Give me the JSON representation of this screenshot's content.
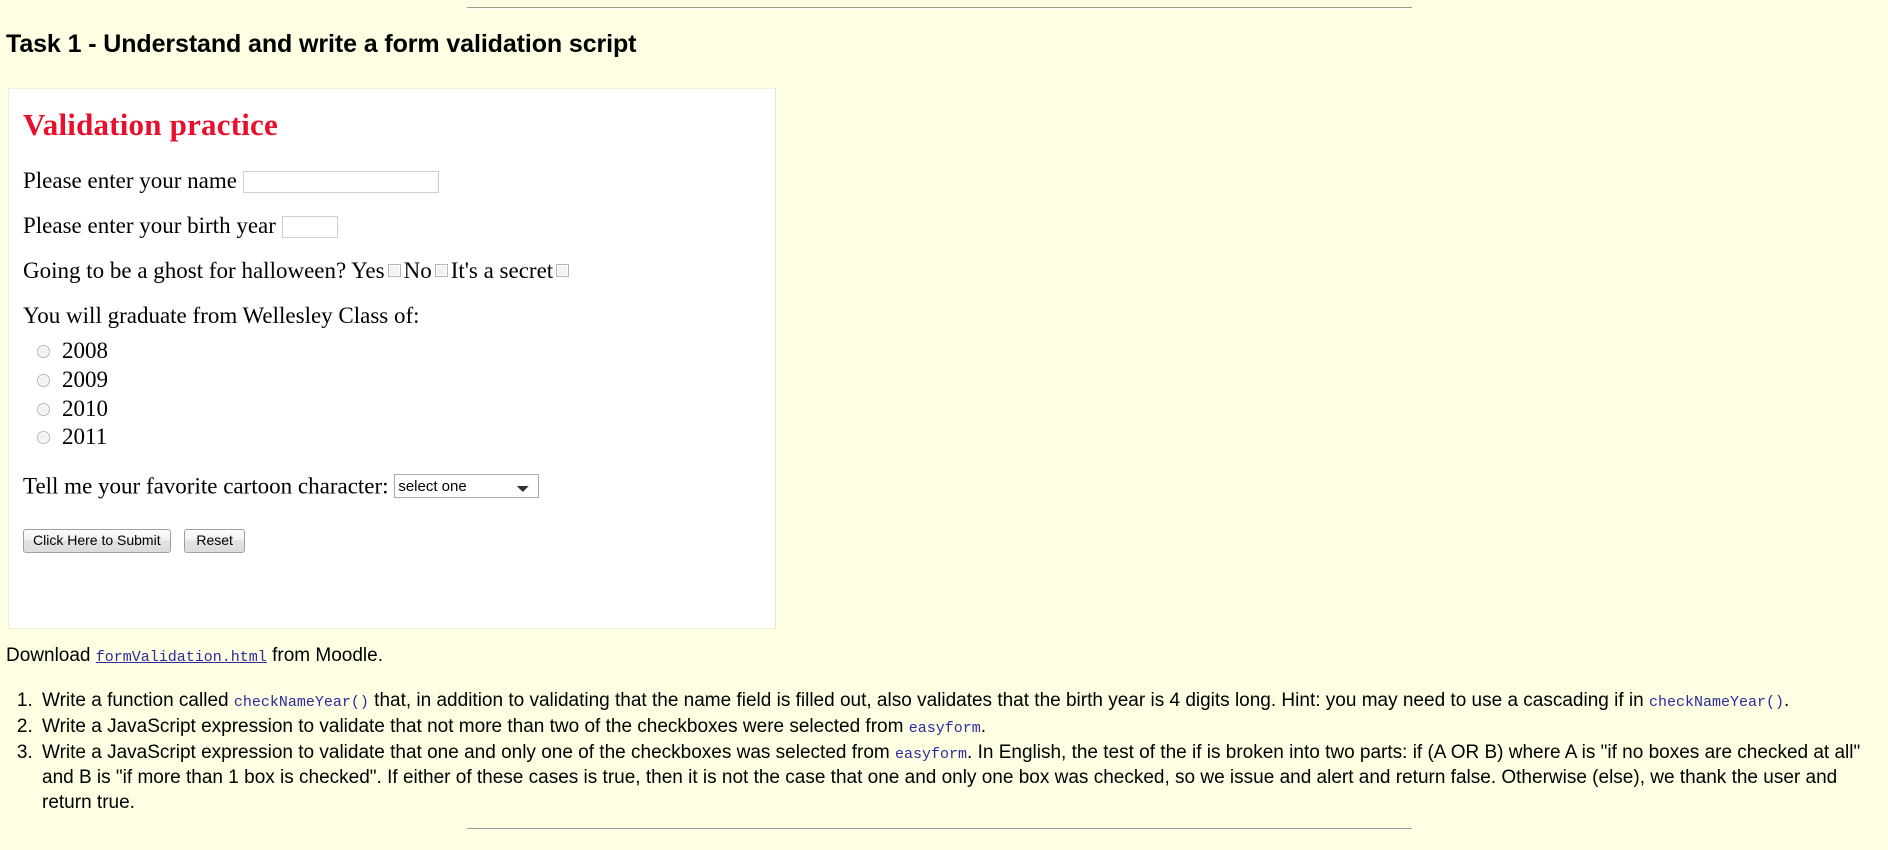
{
  "page": {
    "background_color": "#FEFEE3",
    "task_title": "Task 1 - Understand and write a form validation script"
  },
  "form_panel": {
    "heading": "Validation practice",
    "heading_color": "#E8112D",
    "name_row": {
      "label": "Please enter your name",
      "value": "",
      "placeholder": ""
    },
    "birth_year_row": {
      "label": "Please enter your birth year",
      "value": "",
      "placeholder": ""
    },
    "ghost_row": {
      "question": "Going to be a ghost for halloween?",
      "options": [
        {
          "label": "Yes",
          "checked": false
        },
        {
          "label": "No",
          "checked": false
        },
        {
          "label": "It's a secret",
          "checked": false
        }
      ]
    },
    "graduation": {
      "question": "You will graduate from Wellesley Class of:",
      "options": [
        {
          "label": "2008",
          "selected": false
        },
        {
          "label": "2009",
          "selected": false
        },
        {
          "label": "2010",
          "selected": false
        },
        {
          "label": "2011",
          "selected": false
        }
      ]
    },
    "cartoon_row": {
      "label": "Tell me your favorite cartoon character:",
      "selected": "select one",
      "options": [
        "select one"
      ]
    },
    "buttons": {
      "submit_label": "Click Here to Submit",
      "reset_label": "Reset"
    }
  },
  "download": {
    "before": "Download",
    "link_text": "formValidation.html",
    "after": "from Moodle."
  },
  "tasks": [
    {
      "part1": "Write a function called",
      "code1": "checkNameYear()",
      "part2": "that, in addition to validating that the name field is filled out, also validates that the birth year is 4 digits long. Hint: you may need to use a cascading if in",
      "code2": "checkNameYear()",
      "part3": "."
    },
    {
      "part1": "Write a JavaScript expression to validate that not more than two of the checkboxes were selected from",
      "code1": "easyform",
      "part2": "."
    },
    {
      "part1": "Write a JavaScript expression to validate that one and only one of the checkboxes was selected from",
      "code1": "easyform",
      "part2": ". In English, the test of the if is broken into two parts: if (A OR B) where A is \"if no boxes are checked at all\" and B is \"if more than 1 box is checked\". If either of these cases is true, then it is not the case that one and only one box was checked, so we issue and alert and return false. Otherwise (else), we thank the user and return true."
    }
  ]
}
